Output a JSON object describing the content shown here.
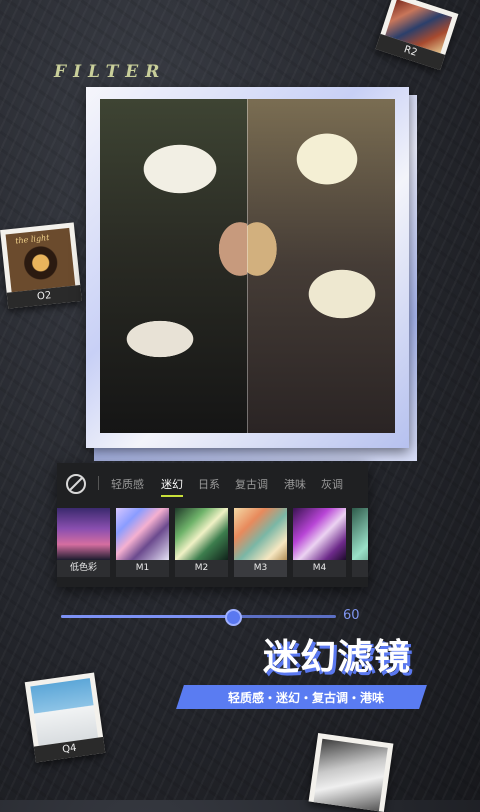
{
  "brand": {
    "logo_text": "FILTER"
  },
  "stickers": [
    {
      "id": "r2",
      "label": "R2"
    },
    {
      "id": "o2",
      "label": "O2",
      "script": "the light"
    },
    {
      "id": "q4",
      "label": "Q4"
    }
  ],
  "filter_panel": {
    "no_filter_icon": "no-filter-icon",
    "categories": [
      {
        "label": "轻质感",
        "active": false
      },
      {
        "label": "迷幻",
        "active": true
      },
      {
        "label": "日系",
        "active": false
      },
      {
        "label": "复古调",
        "active": false
      },
      {
        "label": "港味",
        "active": false
      },
      {
        "label": "灰调",
        "active": false
      }
    ],
    "filters": [
      {
        "label": "低色彩",
        "selected": false
      },
      {
        "label": "M1",
        "selected": false
      },
      {
        "label": "M2",
        "selected": false
      },
      {
        "label": "M3",
        "selected": true
      },
      {
        "label": "M4",
        "selected": false
      },
      {
        "label": "",
        "selected": false
      }
    ],
    "accent_color": "#c9e03a"
  },
  "intensity": {
    "value": 60,
    "fraction": 0.62,
    "color": "#5a78f0"
  },
  "promo": {
    "headline": "迷幻滤镜",
    "tagline": "轻质感・迷幻・复古调・港味"
  }
}
